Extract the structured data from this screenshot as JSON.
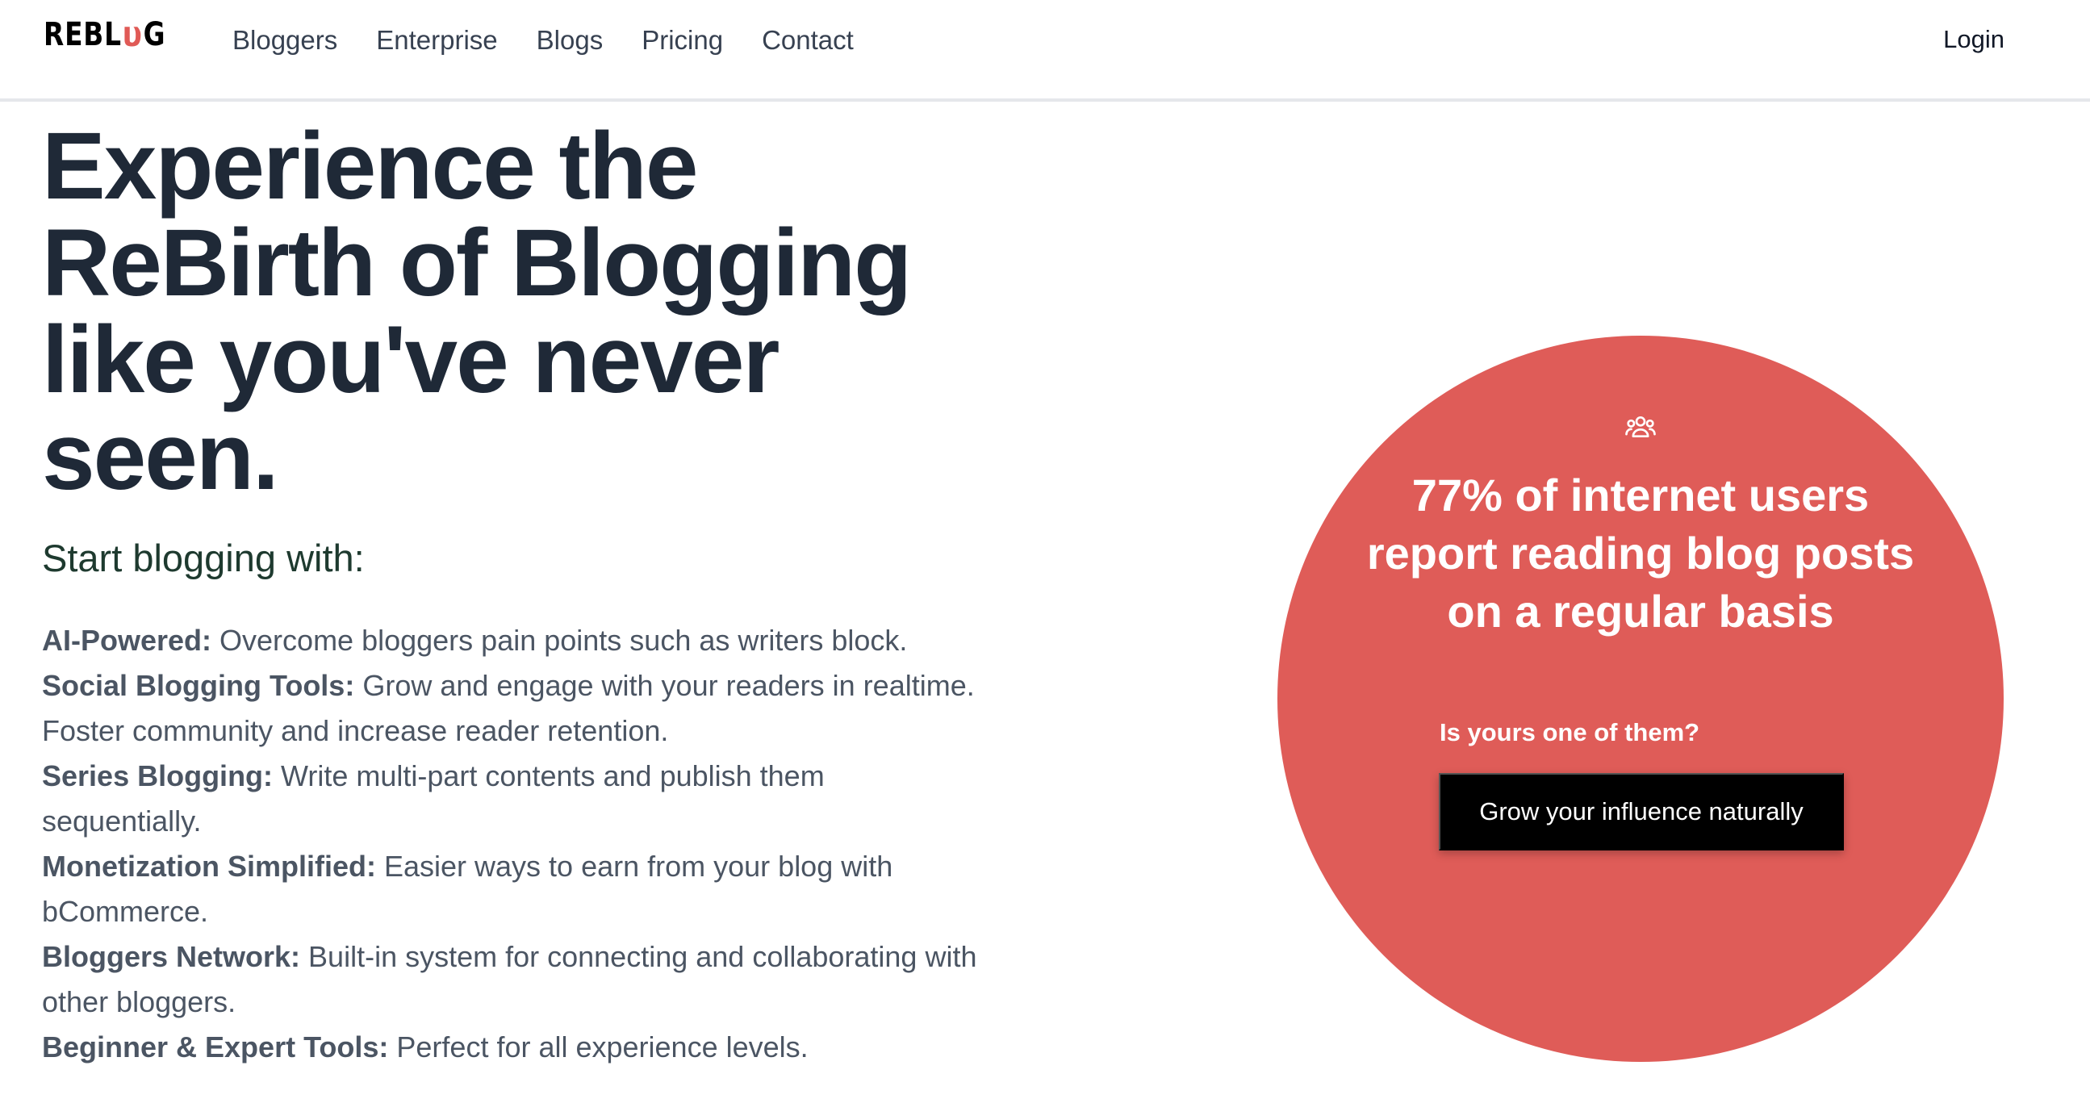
{
  "nav": {
    "logo": {
      "prefix": "REBL",
      "mark": "υ",
      "suffix": "G"
    },
    "links": [
      "Bloggers",
      "Enterprise",
      "Blogs",
      "Pricing",
      "Contact"
    ],
    "login_label": "Login"
  },
  "hero": {
    "title": "Experience the ReBirth of Blogging like you've never seen.",
    "subtitle": "Start blogging with:",
    "features": [
      {
        "label": "AI-Powered:",
        "text": " Overcome bloggers pain points such as writers block."
      },
      {
        "label": "Social Blogging Tools:",
        "text": " Grow and engage with your readers in realtime. Foster community and increase reader retention."
      },
      {
        "label": "Series Blogging:",
        "text": " Write multi-part contents and publish them sequentially."
      },
      {
        "label": "Monetization Simplified:",
        "text": " Easier ways to earn from your blog with bCommerce."
      },
      {
        "label": "Bloggers Network:",
        "text": " Built-in system for connecting and collaborating with other bloggers."
      },
      {
        "label": "Beginner & Expert Tools:",
        "text": " Perfect for all experience levels."
      }
    ]
  },
  "promo": {
    "icon": "users-icon",
    "stat": "77% of internet users report reading blog posts on a regular basis",
    "question": "Is yours one of them?",
    "cta_label": "Grow your influence naturally",
    "circle_color": "#df5c58"
  }
}
